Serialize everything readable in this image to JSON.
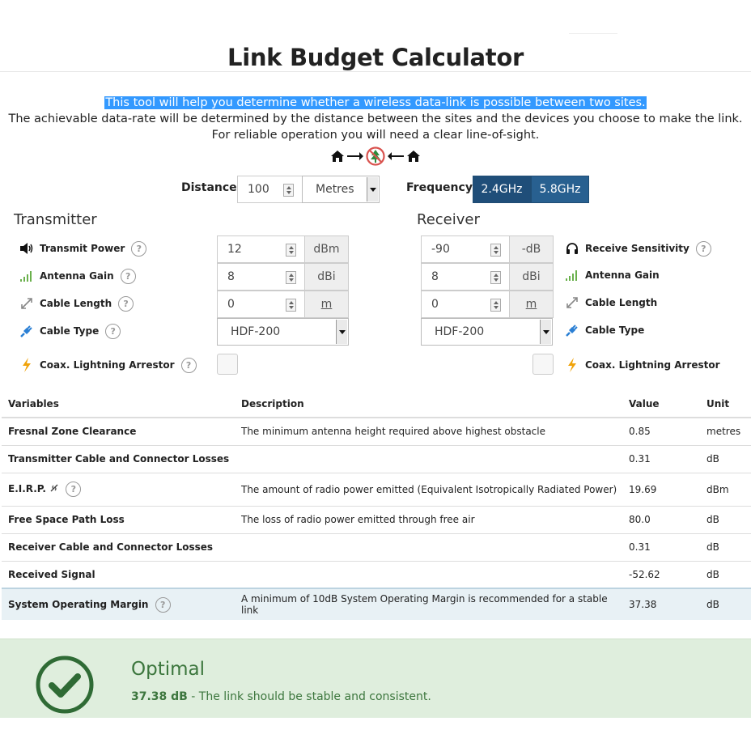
{
  "title": "Link Budget Calculator",
  "intro": {
    "line1": "This tool will help you determine whether a wireless data-link is possible between two sites.",
    "line2": "The achievable data-rate will be determined by the distance between the sites and the devices you choose to make the link.",
    "line3": "For reliable operation you will need a clear line-of-sight."
  },
  "distance": {
    "label": "Distance",
    "value": "100",
    "unit": "Metres"
  },
  "frequency": {
    "label": "Frequency",
    "options": [
      "2.4GHz",
      "5.8GHz"
    ],
    "selected": "2.4GHz"
  },
  "transmitter": {
    "title": "Transmitter",
    "power": {
      "label": "Transmit Power",
      "value": "12",
      "unit": "dBm"
    },
    "gain": {
      "label": "Antenna Gain",
      "value": "8",
      "unit": "dBi"
    },
    "cable_length": {
      "label": "Cable Length",
      "value": "0",
      "unit": "m"
    },
    "cable_type": {
      "label": "Cable Type",
      "value": "HDF-200"
    },
    "arrestor": {
      "label": "Coax. Lightning Arrestor",
      "checked": false
    }
  },
  "receiver": {
    "title": "Receiver",
    "sensitivity": {
      "label": "Receive Sensitivity",
      "value": "-90",
      "unit": "-dB"
    },
    "gain": {
      "label": "Antenna Gain",
      "value": "8",
      "unit": "dBi"
    },
    "cable_length": {
      "label": "Cable Length",
      "value": "0",
      "unit": "m"
    },
    "cable_type": {
      "label": "Cable Type",
      "value": "HDF-200"
    },
    "arrestor": {
      "label": "Coax. Lightning Arrestor",
      "checked": false
    }
  },
  "table": {
    "headers": [
      "Variables",
      "Description",
      "Value",
      "Unit"
    ],
    "rows": [
      {
        "variable": "Fresnal Zone Clearance",
        "description": "The minimum antenna height required above highest obstacle",
        "value": "0.85",
        "unit": "metres"
      },
      {
        "variable": "Transmitter Cable and Connector Losses",
        "description": "",
        "value": "0.31",
        "unit": "dB"
      },
      {
        "variable": "E.I.R.P.",
        "description": "The amount of radio power emitted (Equivalent Isotropically Radiated Power)",
        "value": "19.69",
        "unit": "dBm"
      },
      {
        "variable": "Free Space Path Loss",
        "description": "The loss of radio power emitted through free air",
        "value": "80.0",
        "unit": "dB"
      },
      {
        "variable": "Receiver Cable and Connector Losses",
        "description": "",
        "value": "0.31",
        "unit": "dB"
      },
      {
        "variable": "Received Signal",
        "description": "",
        "value": "-52.62",
        "unit": "dB"
      },
      {
        "variable": "System Operating Margin",
        "description": "A minimum of 10dB System Operating Margin is recommended for a stable link",
        "value": "37.38",
        "unit": "dB"
      }
    ]
  },
  "status": {
    "title": "Optimal",
    "value": "37.38 dB",
    "message": " - The link should be stable and consistent."
  },
  "help_glyph": "?",
  "colors": {
    "primary": "#286090",
    "success": "#3c763d",
    "success_bg": "#dfeedd",
    "highlight": "#3399ff"
  }
}
